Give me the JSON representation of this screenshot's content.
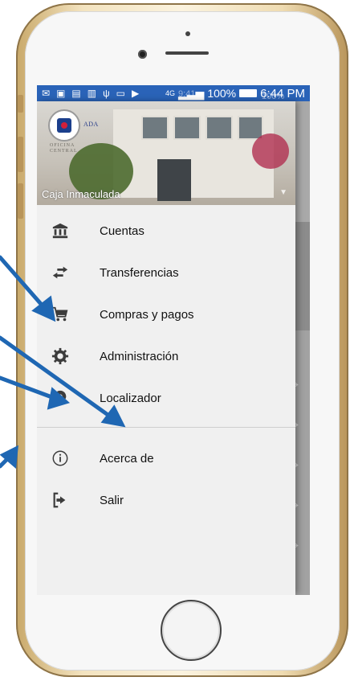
{
  "status_bar": {
    "time": "6:44 PM",
    "battery": "100%",
    "network": "4G",
    "overlay_time": "9:41",
    "overlay_battery": "100%"
  },
  "drawer": {
    "header": {
      "account_name": "Caja Inmaculada",
      "logo_text": "ADA",
      "office_line1": "OFICINA",
      "office_line2": "CENTRAL"
    },
    "items": [
      {
        "label": "Cuentas",
        "icon": "bank-icon"
      },
      {
        "label": "Transferencias",
        "icon": "swap-arrows-icon"
      },
      {
        "label": "Compras y pagos",
        "icon": "cart-icon"
      },
      {
        "label": "Administración",
        "icon": "gear-icon"
      },
      {
        "label": "Localizador",
        "icon": "location-pin-icon"
      }
    ],
    "secondary_items": [
      {
        "label": "Acerca de",
        "icon": "info-icon"
      },
      {
        "label": "Salir",
        "icon": "logout-icon"
      }
    ]
  },
  "colors": {
    "status_bar": "#2a63b8",
    "annotation_arrow": "#1f67b3",
    "frame_gold": "#e8d3a6"
  }
}
